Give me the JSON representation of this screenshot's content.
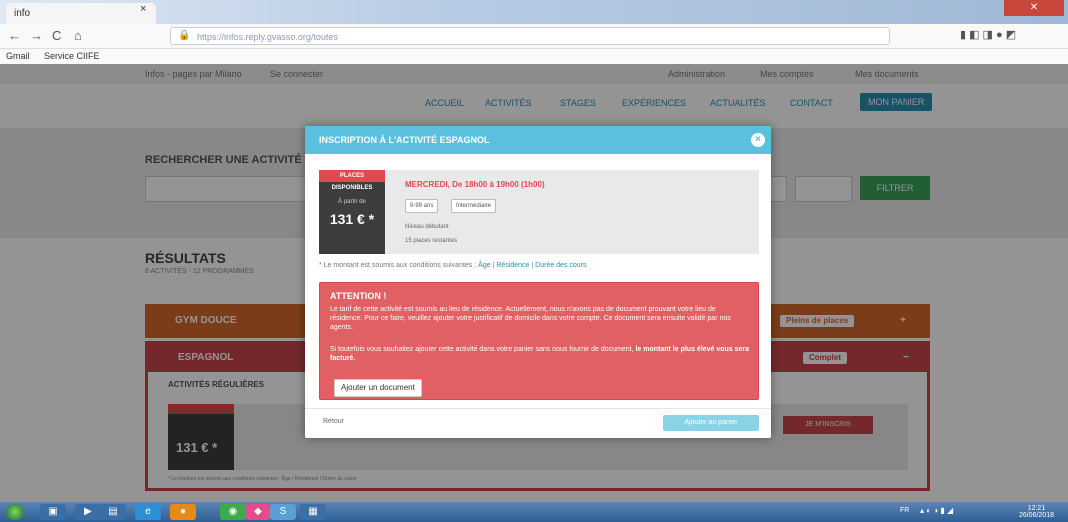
{
  "browser": {
    "tab_label": "info",
    "tab_close": "×",
    "url": "https://infos.reply.gvasso.org/toutes",
    "nav_back": "←",
    "nav_forward": "→",
    "nav_reload": "C",
    "nav_home": "⌂",
    "url_tools": "☰ ··· ◫ ☆",
    "bookmarks": [
      "Gmail",
      "Service CIIFE"
    ]
  },
  "page": {
    "top_links": [
      "Infos - pages par Milano",
      "Se connecter",
      "Administration",
      "Mes comptes",
      "Mes documents"
    ],
    "nav_items": [
      "ACCUEIL",
      "ACTIVITÉS",
      "STAGES",
      "EXPÉRIENCES",
      "ACTUALITÉS",
      "CONTACT"
    ],
    "nav_cta": "MON PANIER",
    "search_title": "RECHERCHER UNE ACTIVITÉ",
    "filter_btn": "FILTRER",
    "results_title": "RÉSULTATS",
    "results_sub": "8 ACTIVITÉS - 12 PROGRAMMES",
    "panel1_title": "GYM DOUCE",
    "panel1_badge": "Pleins de places",
    "panel2_title": "ESPAGNOL",
    "panel2_badge": "Complet",
    "regular_title": "ACTIVITÉS RÉGULIÈRES",
    "bg_price": "131 € *",
    "inscrire_btn": "JE M'INSCRIS",
    "bg_note": "* Le montant est soumis aux conditions suivantes : Âge | Résidence | Durée du cours"
  },
  "modal": {
    "title": "INSCRIPTION À L'ACTIVITÉ ESPAGNOL",
    "close": "×",
    "tag": "PLACES DISPONIBLES",
    "price_label": "À partir de",
    "price": "131 € *",
    "date": "MERCREDI, De 18h00 à 19h00 (1h00)",
    "chips": [
      "9-99 ans",
      "Intermédiaire"
    ],
    "level": "Niveau débutant",
    "places": "15 places restantes",
    "note_prefix": "* Le montant est soumis aux conditions suivantes :",
    "note_links": [
      "Âge",
      "Résidence",
      "Durée des cours"
    ],
    "alert_title": "ATTENTION !",
    "alert_p1": "Le tarif de cette activité est soumis au lieu de résidence. Actuellement, nous n'avons pas de document prouvant votre lieu de résidence. Pour ce faire, veuillez ajouter votre justificatif de domicile dans votre compte. Ce document sera ensuite validé par nos agents.",
    "alert_p2_normal": "Si toutefois vous souhaitez ajouter cette activité dans votre panier sans nous fournir de document,",
    "alert_p2_bold": "le montant le plus élevé vous sera facturé.",
    "add_doc_btn": "Ajouter un document",
    "back_btn": "Retour",
    "cart_btn": "Ajouter au panier"
  },
  "taskbar": {
    "time": "12:21",
    "date": "26/06/2018",
    "lang": "FR"
  }
}
